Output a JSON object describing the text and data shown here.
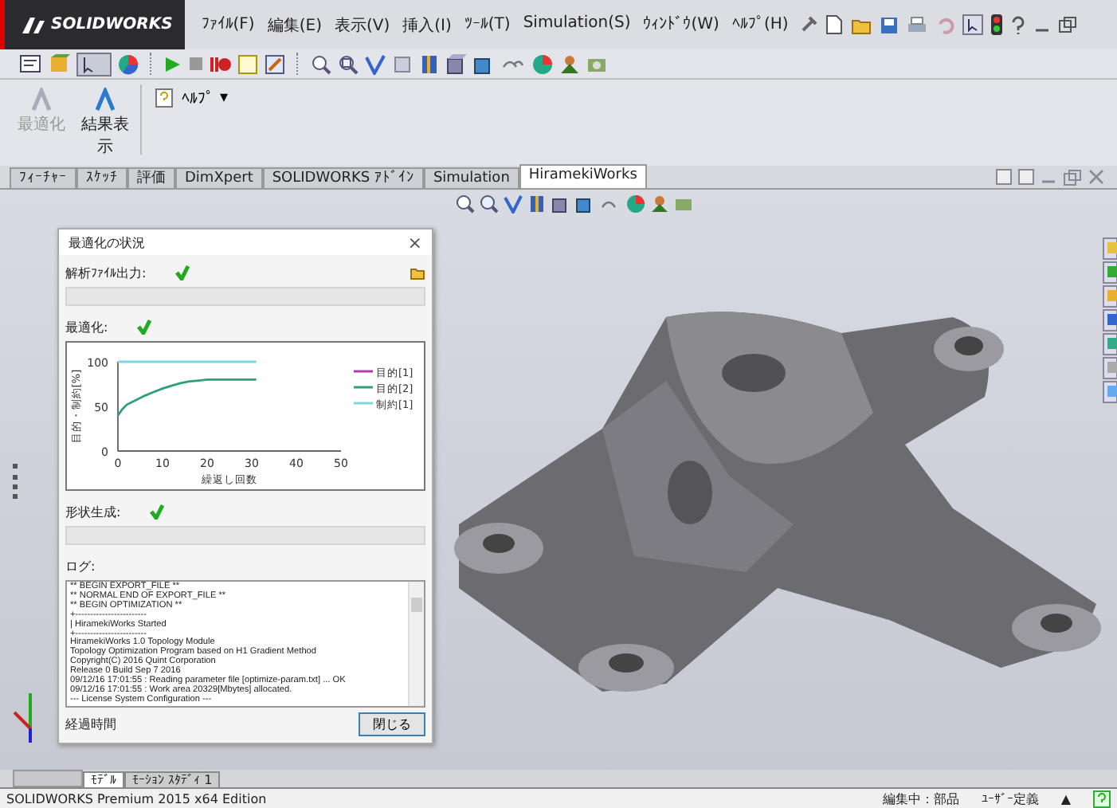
{
  "app": {
    "logo": "SOLIDWORKS"
  },
  "menu": [
    "ﾌｧｲﾙ(F)",
    "編集(E)",
    "表示(V)",
    "挿入(I)",
    "ﾂｰﾙ(T)",
    "Simulation(S)",
    "ｳｨﾝﾄﾞｳ(W)",
    "ﾍﾙﾌﾟ(H)"
  ],
  "ribbon": [
    {
      "label": "最適化",
      "disabled": true
    },
    {
      "label": "結果表示",
      "disabled": false
    }
  ],
  "ribbon_help": "ﾍﾙﾌﾟ",
  "ribbon_help_caret": "▾",
  "tabs": [
    {
      "label": "ﾌｨｰﾁｬｰ",
      "selected": false
    },
    {
      "label": "ｽｹｯﾁ",
      "selected": false
    },
    {
      "label": "評価",
      "selected": false
    },
    {
      "label": "DimXpert",
      "selected": false
    },
    {
      "label": "SOLIDWORKS ｱﾄﾞｲﾝ",
      "selected": false
    },
    {
      "label": "Simulation",
      "selected": false
    },
    {
      "label": "HiramekiWorks",
      "selected": true
    }
  ],
  "dialog": {
    "title": "最適化の状況",
    "close": "×",
    "sections": [
      {
        "label": "解析ﾌｧｲﾙ出力:",
        "done": true
      },
      {
        "label": "最適化:",
        "done": true
      },
      {
        "label": "形状生成:",
        "done": true
      }
    ],
    "chart_data": {
      "type": "line",
      "xlabel": "繰返し回数",
      "ylabel": "目的・制約[%]",
      "x": [
        0,
        1,
        2,
        4,
        6,
        8,
        10,
        12,
        14,
        16,
        18,
        20,
        25,
        31
      ],
      "xlim": [
        0,
        50
      ],
      "ylim": [
        0,
        100
      ],
      "xticks": [
        0,
        10,
        20,
        30,
        40,
        50
      ],
      "yticks": [
        0,
        50,
        100
      ],
      "legend": "right",
      "series": [
        {
          "name": "目的[1]",
          "color": "#b03cb0",
          "values": [
            null,
            null,
            null,
            null,
            null,
            null,
            null,
            null,
            null,
            null,
            null,
            null,
            null,
            null
          ]
        },
        {
          "name": "目的[2]",
          "color": "#2e9e7e",
          "values": [
            40,
            47,
            52,
            57,
            62,
            66,
            70,
            73,
            76,
            78,
            79,
            80,
            80,
            80
          ]
        },
        {
          "name": "制約[1]",
          "color": "#7ed6e0",
          "values": [
            100,
            100,
            100,
            100,
            100,
            100,
            100,
            100,
            100,
            100,
            100,
            100,
            100,
            100
          ]
        }
      ]
    },
    "log_label": "ログ:",
    "log": [
      "** BEGIN EXPORT_FILE **",
      "** NORMAL END OF EXPORT_FILE **",
      "** BEGIN OPTIMIZATION **",
      "+------------------------",
      "| HiramekiWorks Started",
      "+------------------------",
      "HiramekiWorks 1.0 Topology Module",
      "Topology Optimization Program based on H1 Gradient Method",
      "Copyright(C) 2016 Quint Corporation",
      "Release 0 Build Sep  7 2016",
      "09/12/16 17:01:55 : Reading parameter file [optimize-param.txt] ... OK",
      "09/12/16 17:01:55 : Work area 20329[Mbytes] allocated.",
      "--- License System Configuration ---"
    ],
    "elapsed": "経過時間",
    "button": "閉じる"
  },
  "bottom_tabs": [
    {
      "label": "ﾓﾃﾞﾙ",
      "selected": true
    },
    {
      "label": "ﾓｰｼｮﾝ ｽﾀﾃﾞｨ 1",
      "selected": false
    }
  ],
  "status_bar": {
    "edition": "SOLIDWORKS Premium 2015 x64 Edition",
    "editing": "編集中：部品",
    "units": "ﾕｰｻﾞｰ定義",
    "caret": "▲"
  }
}
